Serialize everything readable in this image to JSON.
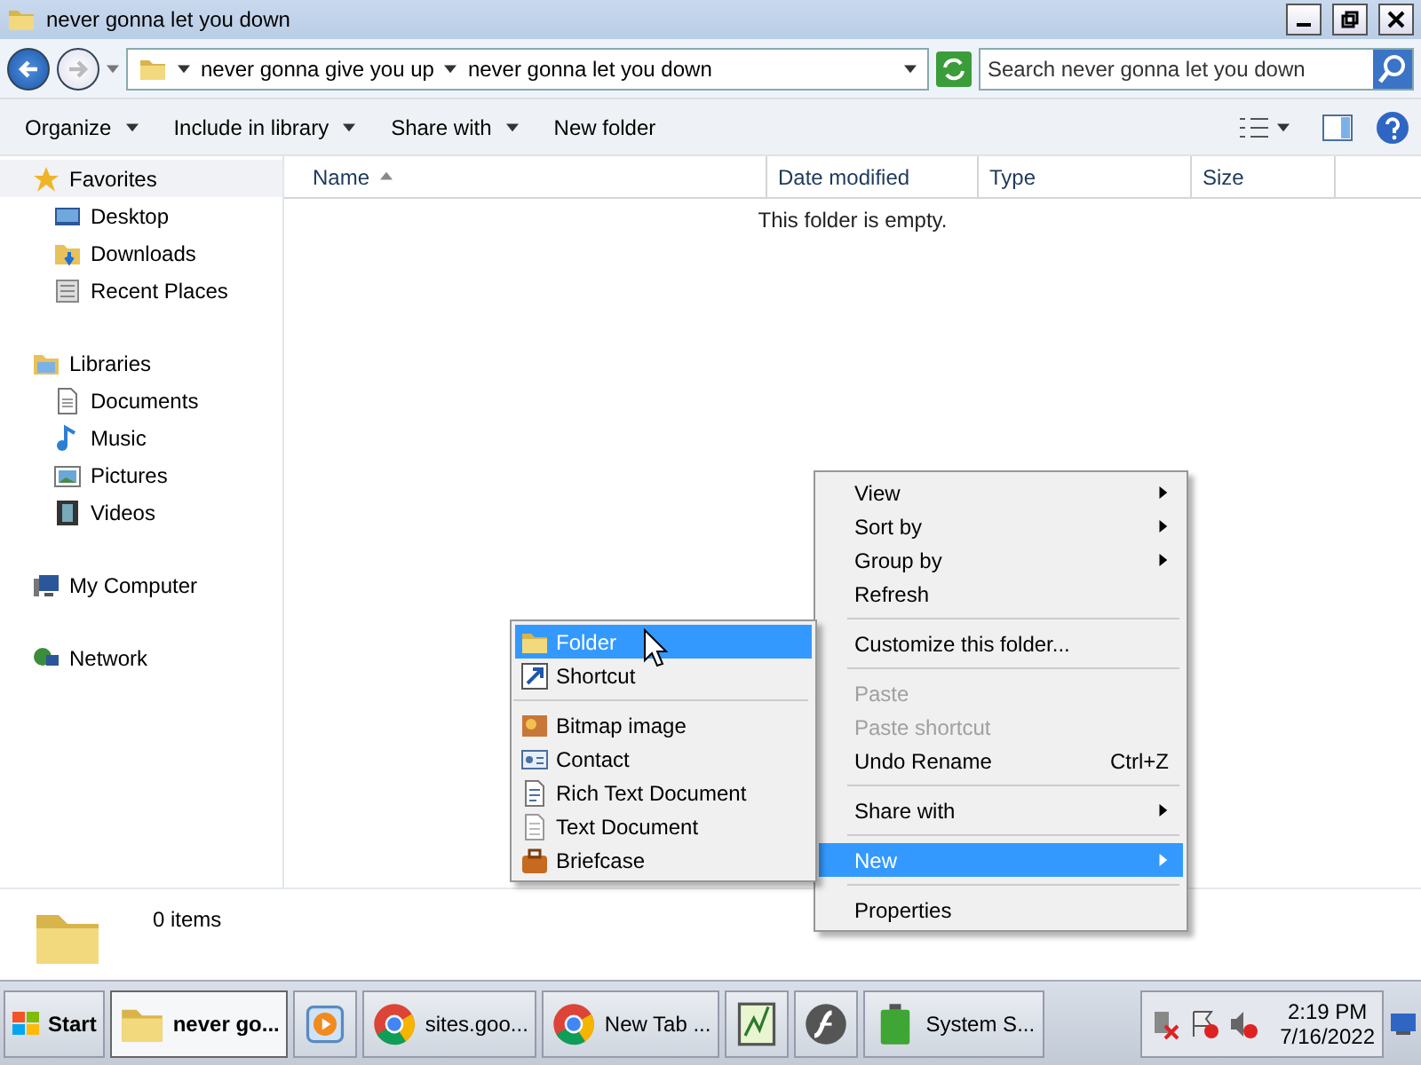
{
  "window": {
    "title": "never gonna let you down"
  },
  "address": {
    "breadcrumbs": [
      "never gonna give you up",
      "never gonna let you down"
    ],
    "search": {
      "placeholder": "Search never gonna let you down"
    }
  },
  "toolbar": [
    {
      "label": "Organize",
      "dropdown": true
    },
    {
      "label": "Include in library",
      "dropdown": true
    },
    {
      "label": "Share with",
      "dropdown": true
    },
    {
      "label": "New folder",
      "dropdown": false
    }
  ],
  "sidebar": [
    {
      "label": "Favorites",
      "selected": true,
      "children": [
        {
          "label": "Desktop",
          "selected": false
        },
        {
          "label": "Downloads",
          "selected": false
        },
        {
          "label": "Recent Places",
          "selected": false
        }
      ]
    },
    {
      "label": "Libraries",
      "selected": false,
      "children": [
        {
          "label": "Documents",
          "selected": false
        },
        {
          "label": "Music",
          "selected": false
        },
        {
          "label": "Pictures",
          "selected": false
        },
        {
          "label": "Videos",
          "selected": false
        }
      ]
    },
    {
      "label": "My Computer",
      "selected": false
    },
    {
      "label": "Network",
      "selected": false
    }
  ],
  "columns": [
    {
      "label": "Name",
      "sorted": true
    },
    {
      "label": "Date modified",
      "sorted": false
    },
    {
      "label": "Type",
      "sorted": false
    },
    {
      "label": "Size",
      "sorted": false
    }
  ],
  "empty_message": "This folder is empty.",
  "context_menu": [
    {
      "kind": "item",
      "label": "View",
      "submenu": true,
      "disabled": false,
      "selected": false
    },
    {
      "kind": "item",
      "label": "Sort by",
      "submenu": true,
      "disabled": false,
      "selected": false
    },
    {
      "kind": "item",
      "label": "Group by",
      "submenu": true,
      "disabled": false,
      "selected": false
    },
    {
      "kind": "item",
      "label": "Refresh",
      "submenu": false,
      "disabled": false,
      "selected": false
    },
    {
      "kind": "separator"
    },
    {
      "kind": "item",
      "label": "Customize this folder...",
      "submenu": false,
      "disabled": false,
      "selected": false
    },
    {
      "kind": "separator"
    },
    {
      "kind": "item",
      "label": "Paste",
      "submenu": false,
      "disabled": true,
      "selected": false
    },
    {
      "kind": "item",
      "label": "Paste shortcut",
      "submenu": false,
      "disabled": true,
      "selected": false
    },
    {
      "kind": "item",
      "label": "Undo Rename",
      "shortcut": "Ctrl+Z",
      "submenu": false,
      "disabled": false,
      "selected": false
    },
    {
      "kind": "separator"
    },
    {
      "kind": "item",
      "label": "Share with",
      "submenu": true,
      "disabled": false,
      "selected": false
    },
    {
      "kind": "separator"
    },
    {
      "kind": "item",
      "label": "New",
      "submenu": true,
      "disabled": false,
      "selected": true
    },
    {
      "kind": "separator"
    },
    {
      "kind": "item",
      "label": "Properties",
      "submenu": false,
      "disabled": false,
      "selected": false
    }
  ],
  "new_submenu": [
    {
      "kind": "item",
      "label": "Folder",
      "selected": true
    },
    {
      "kind": "item",
      "label": "Shortcut",
      "selected": false
    },
    {
      "kind": "separator"
    },
    {
      "kind": "item",
      "label": "Bitmap image",
      "selected": false
    },
    {
      "kind": "item",
      "label": "Contact",
      "selected": false
    },
    {
      "kind": "item",
      "label": "Rich Text Document",
      "selected": false
    },
    {
      "kind": "item",
      "label": "Text Document",
      "selected": false
    },
    {
      "kind": "item",
      "label": "Briefcase",
      "selected": false
    }
  ],
  "details": {
    "count": "0 items"
  },
  "taskbar": {
    "start": "Start",
    "buttons": [
      {
        "label": "never go...",
        "selected": true
      },
      {
        "selected": false
      },
      {
        "label": "sites.goo...",
        "selected": false
      },
      {
        "label": "New Tab ...",
        "selected": false
      },
      {
        "selected": false
      },
      {
        "selected": false
      },
      {
        "label": "System S...",
        "selected": false
      }
    ],
    "clock": {
      "time": "2:19 PM",
      "date": "7/16/2022"
    }
  }
}
